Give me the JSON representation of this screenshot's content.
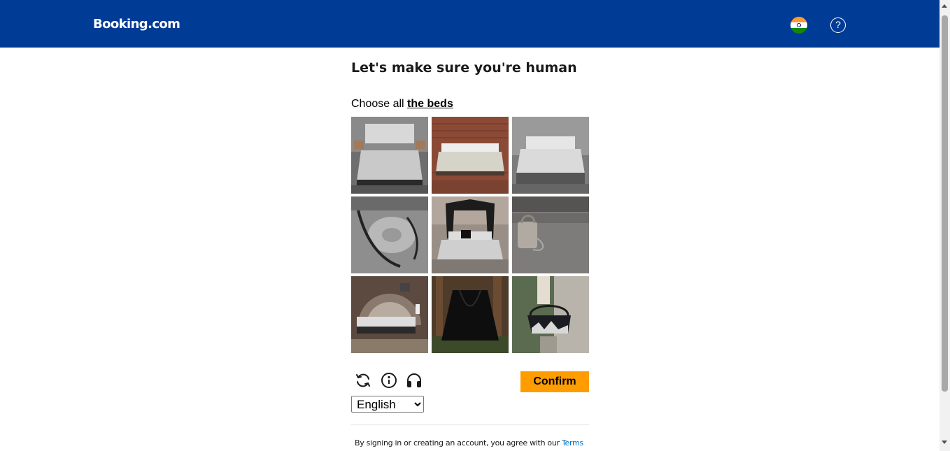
{
  "header": {
    "logo_text": "Booking.com",
    "flag_icon": "india-flag-icon",
    "help_icon": "question-circle-icon",
    "help_symbol": "?",
    "bg_color": "#003b95"
  },
  "challenge": {
    "title": "Let's make sure you're human",
    "prompt_prefix": "Choose all ",
    "prompt_target": "the beds",
    "tiles": [
      {
        "name": "tile-1",
        "icon": "bed-image"
      },
      {
        "name": "tile-2",
        "icon": "bed-brick-wall-image"
      },
      {
        "name": "tile-3",
        "icon": "bed-image"
      },
      {
        "name": "tile-4",
        "icon": "rolled-sleeping-bag-image"
      },
      {
        "name": "tile-5",
        "icon": "canopy-bed-image"
      },
      {
        "name": "tile-6",
        "icon": "bag-image"
      },
      {
        "name": "tile-7",
        "icon": "bed-arched-headboard-image"
      },
      {
        "name": "tile-8",
        "icon": "black-sack-in-forest-image"
      },
      {
        "name": "tile-9",
        "icon": "handbag-image"
      }
    ]
  },
  "controls": {
    "refresh_icon": "refresh-icon",
    "info_icon": "info-icon",
    "audio_icon": "headphones-icon",
    "confirm_label": "Confirm",
    "confirm_color": "#ff9d00",
    "language_selected": "English",
    "language_options": [
      "English"
    ]
  },
  "footer": {
    "terms_text": "By signing in or creating an account, you agree with our ",
    "terms_link": "Terms",
    "link_color": "#0071c2"
  }
}
